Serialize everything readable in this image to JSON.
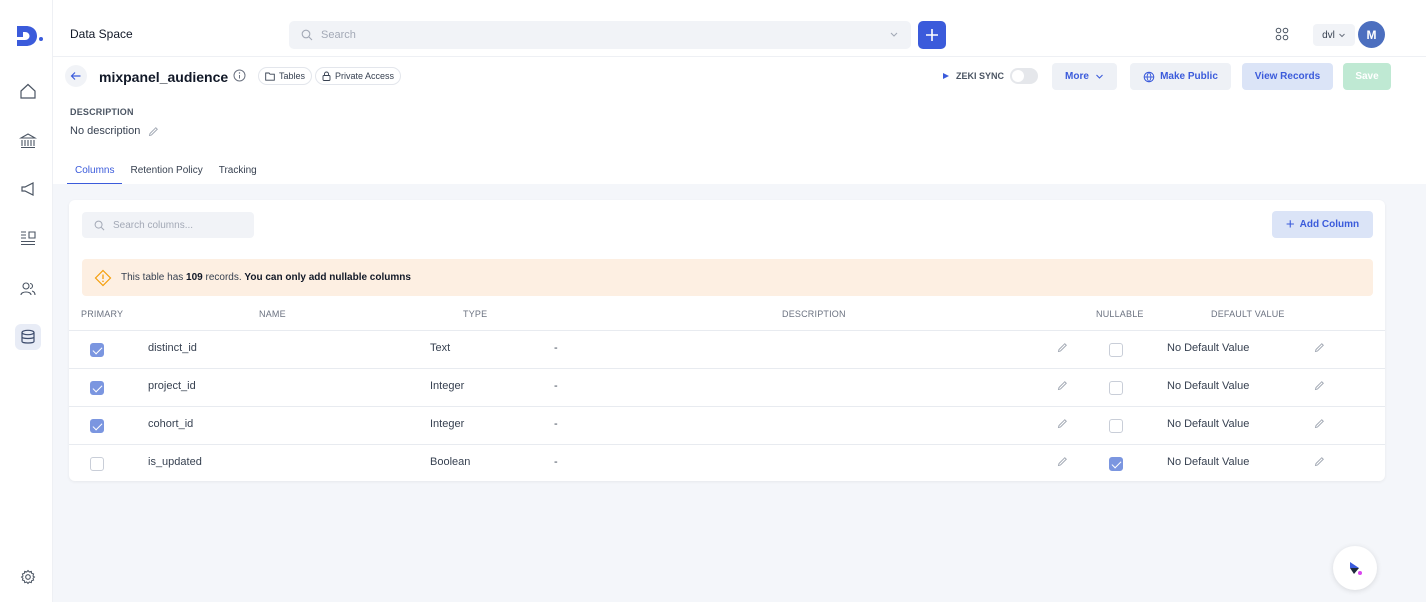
{
  "rail": {
    "items": [
      {
        "icon": "home-icon"
      },
      {
        "icon": "bank-icon"
      },
      {
        "icon": "megaphone-icon"
      },
      {
        "icon": "list-icon"
      },
      {
        "icon": "people-icon"
      },
      {
        "icon": "database-icon"
      }
    ],
    "footer_icon": "settings-icon"
  },
  "topbar": {
    "space_title": "Data Space",
    "search_placeholder": "Search",
    "user_select": "dvl",
    "avatar_initial": "M"
  },
  "header": {
    "table_name": "mixpanel_audience",
    "chip_tables": "Tables",
    "chip_access": "Private Access",
    "zeki_sync_label": "ZEKI SYNC",
    "more_label": "More",
    "make_public_label": "Make Public",
    "view_records_label": "View Records",
    "save_label": "Save",
    "description_label": "DESCRIPTION",
    "description_text": "No description",
    "tabs": [
      {
        "label": "Columns",
        "active": true
      },
      {
        "label": "Retention Policy",
        "active": false
      },
      {
        "label": "Tracking",
        "active": false
      }
    ]
  },
  "columns_panel": {
    "search_placeholder": "Search columns...",
    "add_column_label": "Add Column",
    "warning_prefix": "This table has",
    "warning_count": "109",
    "warning_mid": "records.",
    "warning_bold": "You can only add nullable columns",
    "headers": {
      "primary": "PRIMARY",
      "name": "NAME",
      "type": "TYPE",
      "description": "DESCRIPTION",
      "nullable": "NULLABLE",
      "default_value": "DEFAULT VALUE"
    },
    "rows": [
      {
        "primary": true,
        "name": "distinct_id",
        "type": "Text",
        "description": "-",
        "nullable": false,
        "default_value": "No Default Value"
      },
      {
        "primary": true,
        "name": "project_id",
        "type": "Integer",
        "description": "-",
        "nullable": false,
        "default_value": "No Default Value"
      },
      {
        "primary": true,
        "name": "cohort_id",
        "type": "Integer",
        "description": "-",
        "nullable": false,
        "default_value": "No Default Value"
      },
      {
        "primary": false,
        "name": "is_updated",
        "type": "Boolean",
        "description": "-",
        "nullable": true,
        "default_value": "No Default Value"
      }
    ]
  },
  "colors": {
    "accent": "#3b5bdb",
    "checkbox_on": "#7b96e0",
    "warning_bg": "#fdefe2",
    "save_disabled": "#bfe9d3"
  }
}
